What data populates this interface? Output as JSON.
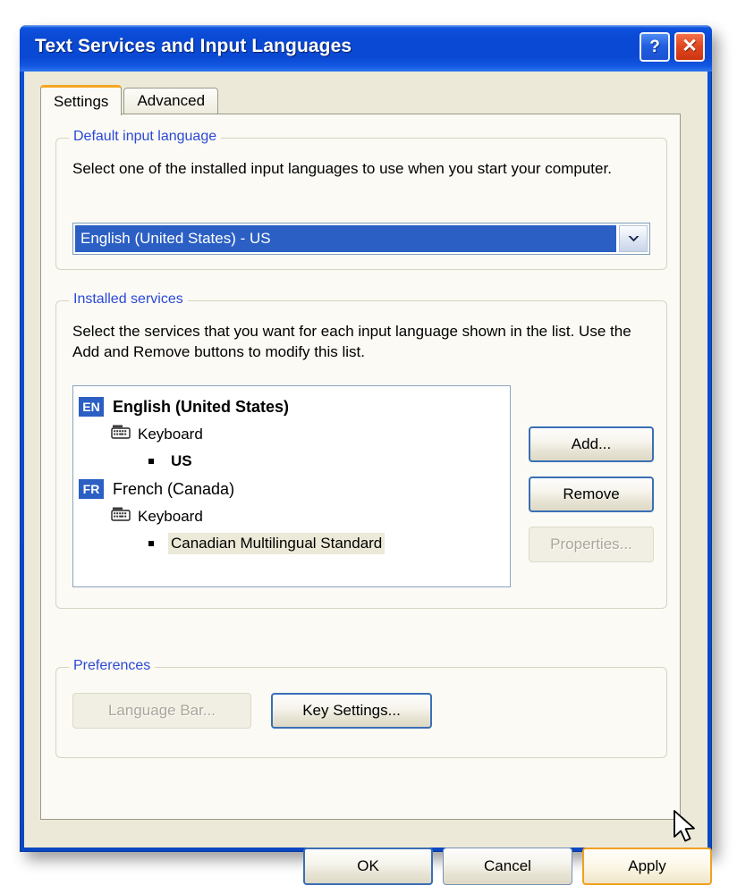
{
  "window": {
    "title": "Text Services and Input Languages",
    "help_button": "?",
    "close_button": "✕"
  },
  "tabs": [
    {
      "label": "Settings",
      "active": true
    },
    {
      "label": "Advanced",
      "active": false
    }
  ],
  "default_input_language": {
    "legend": "Default input language",
    "description": "Select one of the installed input languages to use when you start your computer.",
    "combo_value": "English (United States) - US",
    "combo_arrow": "chevron-down-icon"
  },
  "installed_services": {
    "legend": "Installed services",
    "description": "Select the services that you want for each input language shown in the list. Use the Add and Remove buttons to modify this list.",
    "languages": [
      {
        "badge": "EN",
        "name": "English (United States)",
        "bold": true,
        "category": "Keyboard",
        "items": [
          {
            "label": "US",
            "bold": true,
            "selected": false
          }
        ]
      },
      {
        "badge": "FR",
        "name": "French (Canada)",
        "bold": false,
        "category": "Keyboard",
        "items": [
          {
            "label": "Canadian Multilingual Standard",
            "bold": false,
            "selected": true
          }
        ]
      }
    ],
    "buttons": [
      {
        "label": "Add...",
        "enabled": true
      },
      {
        "label": "Remove",
        "enabled": true
      },
      {
        "label": "Properties...",
        "enabled": false
      }
    ]
  },
  "preferences": {
    "legend": "Preferences",
    "buttons": [
      {
        "label": "Language Bar...",
        "enabled": false
      },
      {
        "label": "Key Settings...",
        "enabled": true
      }
    ]
  },
  "dialog_buttons": [
    {
      "label": "OK",
      "state": "default"
    },
    {
      "label": "Cancel",
      "state": "normal"
    },
    {
      "label": "Apply",
      "state": "hover"
    }
  ],
  "colors": {
    "titlebar_blue": "#0a49d4",
    "accent_blue": "#2b5fc4",
    "legend_blue": "#2b49d6",
    "face": "#ece9d8",
    "panel": "#fbfaf5",
    "hover_orange": "#f0a020",
    "close_red": "#e04a22"
  }
}
